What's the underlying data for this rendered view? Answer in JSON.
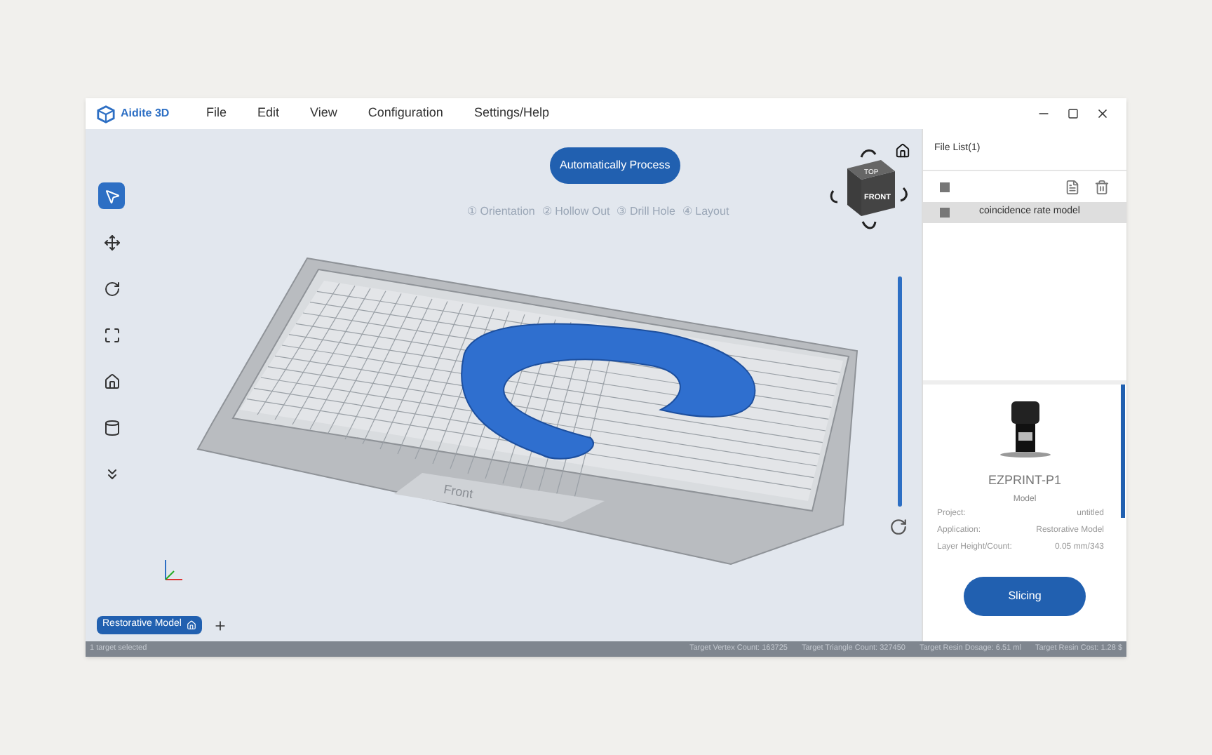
{
  "window": {
    "logo": "Aidite 3D"
  },
  "menu": [
    "File",
    "Edit",
    "View",
    "Configuration",
    "Settings/Help"
  ],
  "tools": [
    {
      "kind": "select",
      "selected": true
    },
    {
      "kind": "move",
      "selected": false
    },
    {
      "kind": "rotate",
      "selected": false
    },
    {
      "kind": "scale",
      "selected": false
    },
    {
      "kind": "support",
      "selected": false
    },
    {
      "kind": "cylinder",
      "selected": false
    },
    {
      "kind": "drop",
      "selected": false
    }
  ],
  "process_button": "Automatically Process",
  "steps": [
    {
      "number": "①",
      "label": "Orientation"
    },
    {
      "number": "②",
      "label": "Hollow Out"
    },
    {
      "number": "③",
      "label": "Drill Hole"
    },
    {
      "number": "④",
      "label": "Layout"
    }
  ],
  "view_cube": {
    "top": "TOP",
    "front": "FRONT"
  },
  "plate": {
    "front_label": "Front"
  },
  "height_slider": {
    "level": 1
  },
  "model_tab": "Restorative Model",
  "file_list": {
    "title": "File List(1)",
    "select_all_checked": true,
    "files": [
      {
        "name": "coincidence rate model",
        "selected": true,
        "checked": true
      }
    ]
  },
  "printer": {
    "name": "EZPRINT-P1",
    "subtitle": "Model",
    "details": [
      {
        "label": "Project:",
        "value": "untitled"
      },
      {
        "label": "Application:",
        "value": "Restorative Model"
      },
      {
        "label": "Layer Height/Count:",
        "value": "0.05 mm/343"
      }
    ]
  },
  "slicing_button": "Slicing",
  "status_bar": {
    "selection": "1 target selected",
    "stats": [
      "Target Vertex Count: 163725",
      "Target Triangle Count: 327450",
      "Target Resin Dosage: 6.51 ml",
      "Target Resin Cost: 1.28 $"
    ]
  }
}
